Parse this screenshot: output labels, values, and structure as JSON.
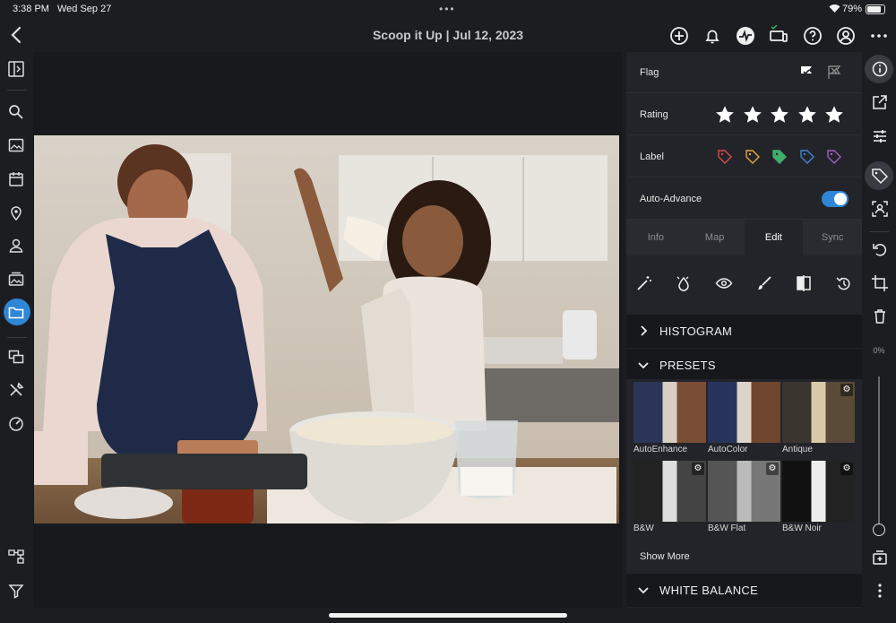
{
  "status_bar": {
    "time": "3:38 PM",
    "date": "Wed Sep 27",
    "battery": "79%"
  },
  "header": {
    "title": "Scoop it Up | Jul 12, 2023"
  },
  "panel": {
    "flag_label": "Flag",
    "rating_label": "Rating",
    "rating_stars": 5,
    "label_label": "Label",
    "auto_advance_label": "Auto-Advance",
    "auto_advance_on": true,
    "tabs": [
      "Info",
      "Map",
      "Edit",
      "Sync"
    ],
    "active_tab": "Edit",
    "sections": {
      "histogram": "HISTOGRAM",
      "presets": "PRESETS",
      "white_balance": "WHITE BALANCE"
    },
    "presets": [
      "AutoEnhance",
      "AutoColor",
      "Antique",
      "B&W",
      "B&W Flat",
      "B&W Noir"
    ],
    "show_more": "Show More"
  },
  "right_rail": {
    "zoom_percent": "0%"
  },
  "colors": {
    "accent": "#2f86d6",
    "panel_bg": "#23242a",
    "section_bg": "#17181b"
  },
  "icons": {
    "left_rail": [
      "panel-toggle-icon",
      "search-icon",
      "photos-icon",
      "calendar-icon",
      "location-icon",
      "people-icon",
      "shared-albums-icon",
      "folder-icon",
      "versions-icon",
      "tools-icon",
      "speed-icon",
      "hierarchy-icon",
      "filter-icon"
    ],
    "right_rail": [
      "info-icon",
      "share-icon",
      "adjust-icon",
      "tag-icon",
      "person-detect-icon",
      "rotate-icon",
      "crop-icon",
      "delete-icon",
      "add-icon",
      "more-icon"
    ]
  }
}
